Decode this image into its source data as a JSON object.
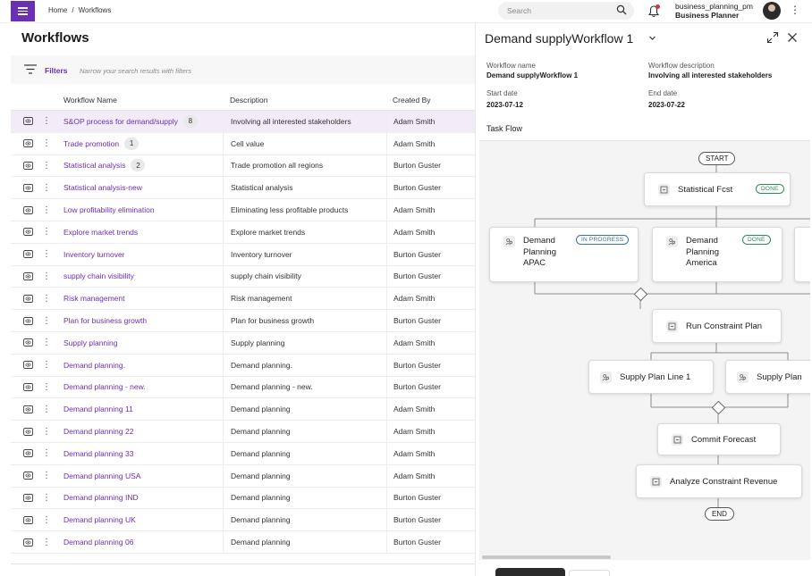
{
  "breadcrumb": [
    "Home",
    "/",
    "Workflows"
  ],
  "search": {
    "placeholder": "Search"
  },
  "user": {
    "name": "business_planning_pm",
    "role": "Business Planner"
  },
  "page_title": "Workflows",
  "filters": {
    "label": "Filters",
    "hint": "Narrow your search results with filters"
  },
  "table": {
    "columns": [
      "Workflow Name",
      "Description",
      "Created By"
    ],
    "rows": [
      {
        "name": "S&OP process for demand/supply",
        "count": "8",
        "description": "Involving all interested stakeholders",
        "created_by": "Adam Smith",
        "selected": true
      },
      {
        "name": "Trade promotion",
        "count": "1",
        "description": "Cell value",
        "created_by": "Adam Smith"
      },
      {
        "name": "Statistical analysis",
        "count": "2",
        "description": "Trade promotion all regions",
        "created_by": "Burton Guster"
      },
      {
        "name": "Statistical analysis-new",
        "count": "",
        "description": "Statistical analysis",
        "created_by": "Burton Guster"
      },
      {
        "name": "Low profitability elimination",
        "count": "",
        "description": "Eliminating less profitable products",
        "created_by": "Adam Smith"
      },
      {
        "name": "Explore market trends",
        "count": "",
        "description": "Explore market trends",
        "created_by": "Adam Smith"
      },
      {
        "name": "Inventory turnover",
        "count": "",
        "description": "Inventory turnover",
        "created_by": "Burton Guster"
      },
      {
        "name": "supply chain visibility",
        "count": "",
        "description": "supply chain visibility",
        "created_by": "Burton Guster"
      },
      {
        "name": "Risk management",
        "count": "",
        "description": "Risk management",
        "created_by": "Adam Smith"
      },
      {
        "name": "Plan for business growth",
        "count": "",
        "description": "Plan for business growth",
        "created_by": "Burton Guster"
      },
      {
        "name": "Supply planning",
        "count": "",
        "description": "Supply planning",
        "created_by": "Adam Smith"
      },
      {
        "name": "Demand planning.",
        "count": "",
        "description": "Demand planning.",
        "created_by": "Burton Guster"
      },
      {
        "name": "Demand planning - new.",
        "count": "",
        "description": "Demand planning - new.",
        "created_by": "Burton Guster"
      },
      {
        "name": "Demand planning 11",
        "count": "",
        "description": "Demand planning",
        "created_by": "Adam Smith"
      },
      {
        "name": "Demand planning 22",
        "count": "",
        "description": "Demand planning",
        "created_by": "Adam Smith"
      },
      {
        "name": "Demand planning 33",
        "count": "",
        "description": "Demand planning",
        "created_by": "Adam Smith"
      },
      {
        "name": "Demand planning USA",
        "count": "",
        "description": "Demand planning",
        "created_by": "Adam Smith"
      },
      {
        "name": "Demand planning IND",
        "count": "",
        "description": "Demand planning",
        "created_by": "Burton Guster"
      },
      {
        "name": "Demand planning UK",
        "count": "",
        "description": "Demand planning",
        "created_by": "Burton Guster"
      },
      {
        "name": "Demand planning 06",
        "count": "",
        "description": "Demand planning",
        "created_by": "Burton Guster"
      }
    ]
  },
  "detail": {
    "title": "Demand supplyWorkflow 1",
    "workflow_name_label": "Workflow name",
    "workflow_name": "Demand supplyWorkflow 1",
    "workflow_desc_label": "Workflow description",
    "workflow_desc": "Involving all interested stakeholders",
    "start_label": "Start date",
    "start_date": "2023-07-12",
    "end_label": "End date",
    "end_date": "2023-07-22",
    "task_flow_label": "Task Flow"
  },
  "flow": {
    "start": "START",
    "end": "END",
    "statistical_fcst": "Statistical Fcst",
    "dp_apac": "Demand Planning APAC",
    "dp_america": "Demand Planning America",
    "run_constraint": "Run Constraint Plan",
    "supply_line1": "Supply Plan Line 1",
    "supply_line2": "Supply Plan",
    "commit_forecast": "Commit Forecast",
    "analyze_revenue": "Analyze Constraint Revenue",
    "status_done": "DONE",
    "status_progress": "IN PROGRESS"
  },
  "colors": {
    "brand": "#6b2fb3",
    "done": "#2e8b57",
    "progress": "#3a6fb5",
    "notification": "#d0304a"
  }
}
